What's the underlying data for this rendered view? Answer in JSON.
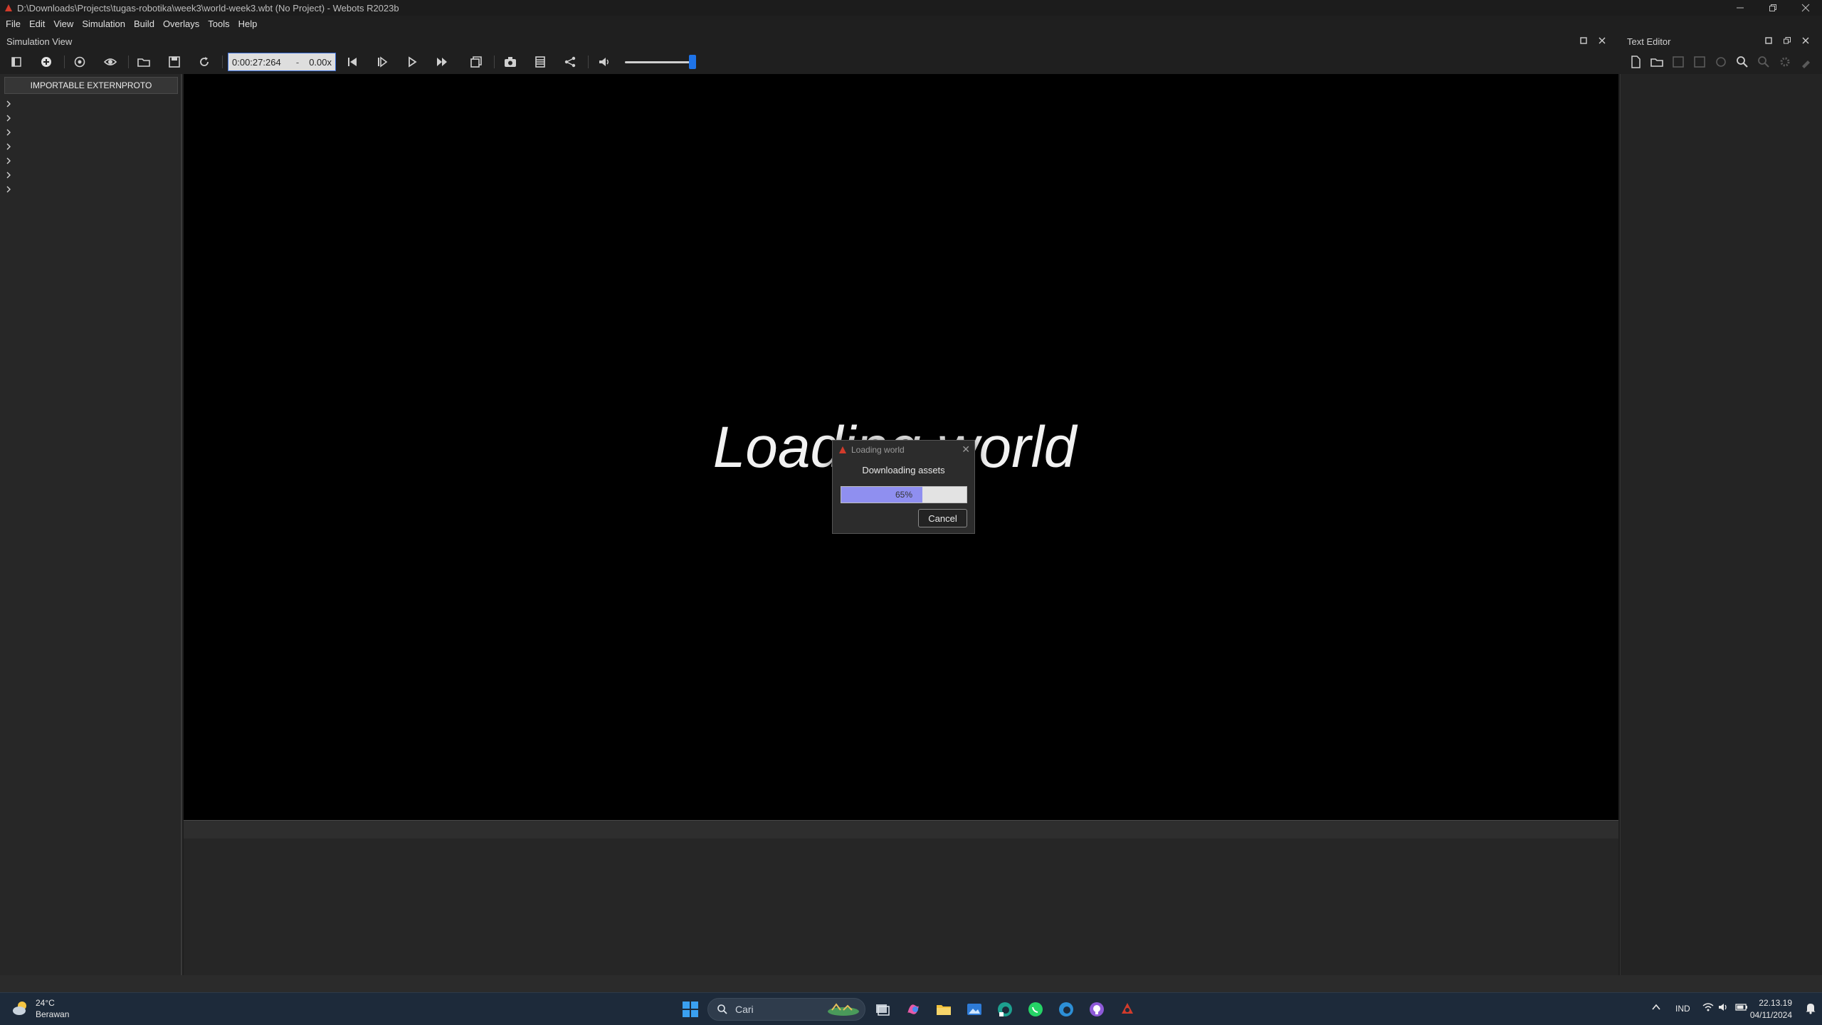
{
  "window": {
    "title": "D:\\Downloads\\Projects\\tugas-robotika\\week3\\world-week3.wbt (No Project) - Webots R2023b",
    "controls": [
      "minimize",
      "restore",
      "close"
    ]
  },
  "menu": [
    "File",
    "Edit",
    "View",
    "Simulation",
    "Build",
    "Overlays",
    "Tools",
    "Help"
  ],
  "simulation_view": {
    "title": "Simulation View",
    "time": "0:00:27:264",
    "time_separator": "-",
    "speed": "0.00x",
    "volume_percent": 100
  },
  "scene_tree": {
    "proto_button": "IMPORTABLE EXTERNPROTO",
    "collapsed_nodes": 7
  },
  "viewport": {
    "overlay_text": "Loading world"
  },
  "dialog": {
    "title": "Loading world",
    "message": "Downloading assets",
    "progress_percent": 65,
    "progress_label": "65%",
    "cancel_label": "Cancel"
  },
  "text_editor": {
    "title": "Text Editor"
  },
  "taskbar": {
    "weather_temp": "24°C",
    "weather_desc": "Berawan",
    "search_placeholder": "Cari",
    "language": "IND",
    "time": "22.13.19",
    "date": "04/11/2024"
  },
  "colors": {
    "accent_blue": "#1e73e8",
    "progress_fill": "#8f8ff0",
    "viewport_bg": "#000000",
    "webots_red": "#d23b2b"
  }
}
